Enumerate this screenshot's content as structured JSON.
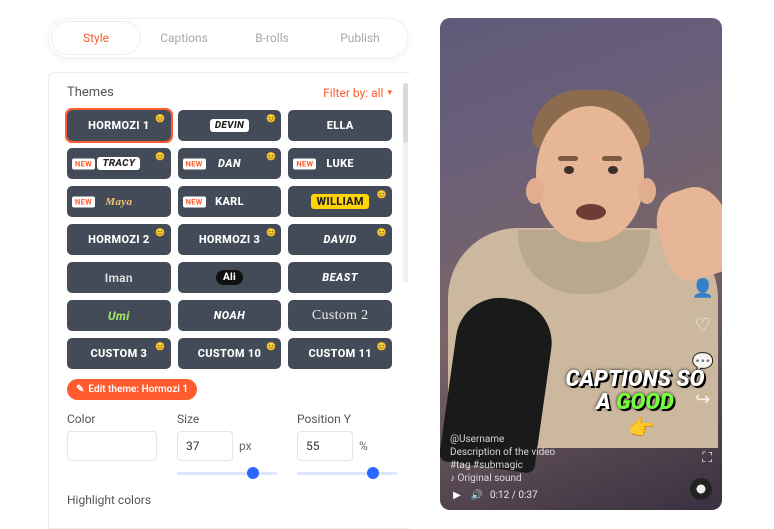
{
  "tabs": [
    {
      "label": "Style",
      "active": true
    },
    {
      "label": "Captions",
      "active": false
    },
    {
      "label": "B-rolls",
      "active": false
    },
    {
      "label": "Publish",
      "active": false
    }
  ],
  "section_title": "Themes",
  "filter": {
    "label": "Filter by: all"
  },
  "themes": [
    {
      "name": "HORMOZI 1",
      "style": "",
      "new": false,
      "dot": true,
      "selected": true
    },
    {
      "name": "Devin",
      "style": "style-pill",
      "new": false,
      "dot": true,
      "selected": false
    },
    {
      "name": "ELLA",
      "style": "",
      "new": false,
      "dot": false,
      "selected": false
    },
    {
      "name": "TRACY",
      "style": "style-pill",
      "new": true,
      "dot": true,
      "selected": false
    },
    {
      "name": "DAN",
      "style": "style-italic",
      "new": true,
      "dot": true,
      "selected": false
    },
    {
      "name": "LUKE",
      "style": "",
      "new": true,
      "dot": false,
      "selected": false
    },
    {
      "name": "Maya",
      "style": "style-orange",
      "new": true,
      "dot": false,
      "selected": false
    },
    {
      "name": "KARL",
      "style": "",
      "new": true,
      "dot": false,
      "selected": false
    },
    {
      "name": "WILLIAM",
      "style": "style-yellow",
      "new": false,
      "dot": true,
      "selected": false
    },
    {
      "name": "HORMOZI 2",
      "style": "",
      "new": false,
      "dot": true,
      "selected": false
    },
    {
      "name": "HORMOZI 3",
      "style": "",
      "new": false,
      "dot": true,
      "selected": false
    },
    {
      "name": "DAVID",
      "style": "style-italic",
      "new": false,
      "dot": true,
      "selected": false
    },
    {
      "name": "Iman",
      "style": "style-plain",
      "new": false,
      "dot": false,
      "selected": false
    },
    {
      "name": "Ali",
      "style": "style-black",
      "new": false,
      "dot": false,
      "selected": false
    },
    {
      "name": "BEAST",
      "style": "style-italic",
      "new": false,
      "dot": false,
      "selected": false
    },
    {
      "name": "Umi",
      "style": "style-green",
      "new": false,
      "dot": false,
      "selected": false
    },
    {
      "name": "NOAH",
      "style": "style-italic",
      "new": false,
      "dot": false,
      "selected": false
    },
    {
      "name": "Custom 2",
      "style": "style-script",
      "new": false,
      "dot": false,
      "selected": false
    },
    {
      "name": "CUSTOM 3",
      "style": "",
      "new": false,
      "dot": true,
      "selected": false
    },
    {
      "name": "CUSTOM 10",
      "style": "",
      "new": false,
      "dot": true,
      "selected": false
    },
    {
      "name": "CUSTOM 11",
      "style": "",
      "new": false,
      "dot": true,
      "selected": false
    }
  ],
  "edit_btn": "Edit theme: Hormozi 1",
  "controls": {
    "color": {
      "label": "Color",
      "value": ""
    },
    "size": {
      "label": "Size",
      "value": "37",
      "unit": "px",
      "slider_pct": 70
    },
    "posy": {
      "label": "Position Y",
      "value": "55",
      "unit": "%",
      "slider_pct": 70
    }
  },
  "highlight_label": "Highlight colors",
  "preview": {
    "caption_line1": "CAPTIONS SO",
    "caption_line2a": "A ",
    "caption_line2b": "GOOD",
    "emoji": "👉",
    "username": "@Username",
    "desc": "Description of the video",
    "tag": "#tag #submagic",
    "sound": "♪ Original sound",
    "time": "0:12 / 0:37",
    "side_icons": [
      "👤",
      "♡",
      "💬",
      "↪"
    ]
  }
}
